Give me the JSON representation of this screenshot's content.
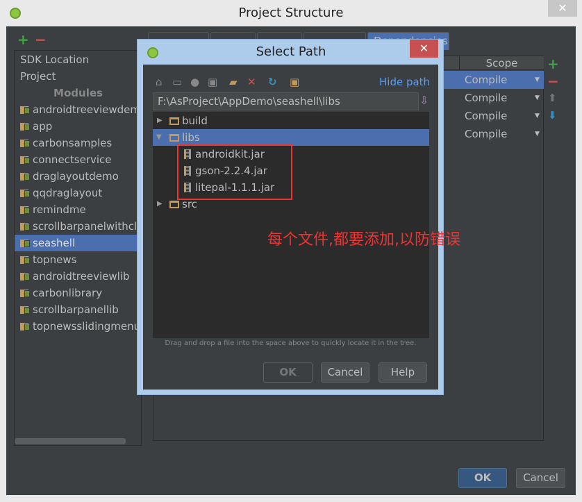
{
  "window": {
    "title": "Project Structure",
    "close": "✕",
    "ok": "OK",
    "cancel": "Cancel"
  },
  "left": {
    "add": "+",
    "remove": "−",
    "items": [
      "SDK Location",
      "Project"
    ],
    "modules_header": "Modules",
    "modules": [
      "androidtreeviewdemo",
      "app",
      "carbonsamples",
      "connectservice",
      "draglayoutdemo",
      "qqdraglayout",
      "remindme",
      "scrollbarpanelwithclock",
      "seashell",
      "topnews",
      "androidtreeviewlib",
      "carbonlibrary",
      "scrollbarpanellib",
      "topnewsslidingmenu"
    ],
    "selected": "seashell"
  },
  "right": {
    "active_tab": "Dependencies",
    "scope_header": "Scope",
    "scopes": [
      "Compile",
      "Compile",
      "Compile",
      "Compile"
    ],
    "add": "+",
    "remove": "−"
  },
  "dialog": {
    "title": "Select Path",
    "close": "✕",
    "hide_path": "Hide path",
    "path": "F:\\AsProject\\AppDemo\\seashell\\libs",
    "tree": {
      "build": "build",
      "libs": "libs",
      "jars": [
        "androidkit.jar",
        "gson-2.2.4.jar",
        "litepal-1.1.1.jar"
      ],
      "src": "src"
    },
    "hint": "Drag and drop a file into the space above to quickly locate it in the tree.",
    "ok": "OK",
    "cancel": "Cancel",
    "help": "Help"
  },
  "annotation": "每个文件,都要添加,以防错误",
  "colors": {
    "selection": "#4b6eaf",
    "annotation": "#ee3333",
    "dialog_frame": "#adcbea"
  }
}
